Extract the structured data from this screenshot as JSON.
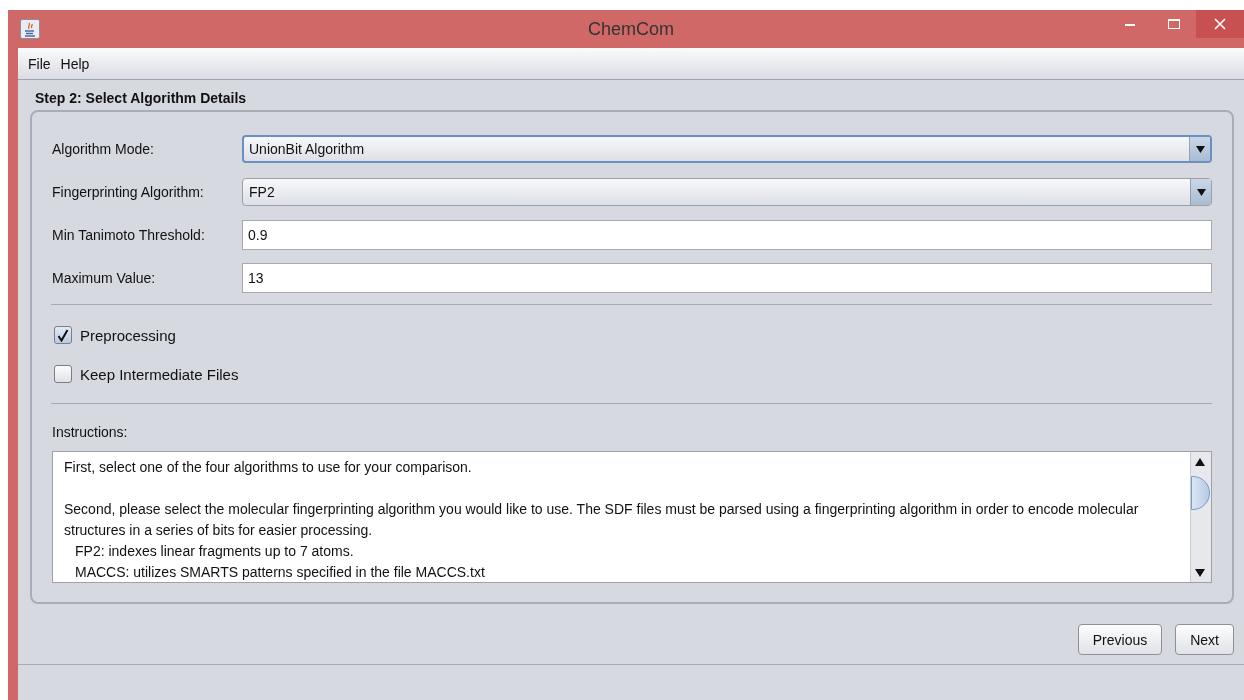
{
  "window": {
    "title": "ChemCom"
  },
  "menu": [
    "File",
    "Help"
  ],
  "step_title": "Step 2: Select Algorithm Details",
  "fields": [
    {
      "kind": "combo",
      "label": "Algorithm Mode:",
      "value": "UnionBit Algorithm",
      "focused": true
    },
    {
      "kind": "combo",
      "label": "Fingerprinting Algorithm:",
      "value": "FP2",
      "focused": false
    },
    {
      "kind": "text",
      "label": "Min Tanimoto Threshold:",
      "value": "0.9"
    },
    {
      "kind": "text",
      "label": "Maximum Value:",
      "value": "13"
    }
  ],
  "options": [
    {
      "label": "Preprocessing",
      "checked": true
    },
    {
      "label": "Keep Intermediate Files",
      "checked": false
    }
  ],
  "instructions": {
    "label": "Instructions:",
    "lines": [
      {
        "kind": "paragraph",
        "text": "First, select one of the four algorithms to use for your comparison."
      },
      {
        "kind": "paragraph",
        "text": "Second, please select the molecular fingerprinting algorithm you would like to use. The SDF files must be parsed using a fingerprinting algorithm in order to encode molecular structures in a series of bits for easier processing."
      },
      {
        "kind": "item",
        "text": "FP2: indexes linear fragments up to 7 atoms."
      },
      {
        "kind": "item",
        "text": "MACCS: utilizes SMARTS patterns specified in the file MACCS.txt"
      }
    ]
  },
  "buttons": [
    "Previous",
    "Next"
  ]
}
